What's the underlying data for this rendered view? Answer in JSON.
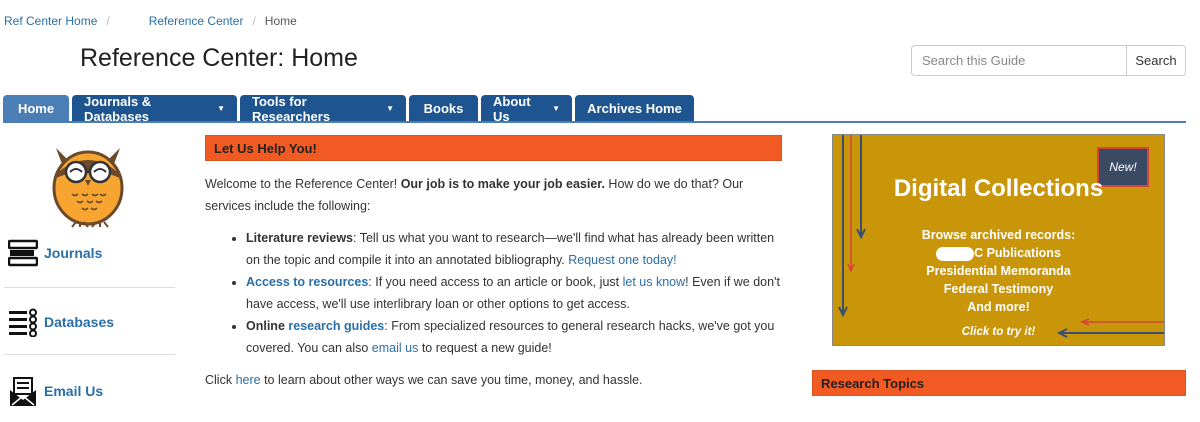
{
  "breadcrumb": {
    "home": "Ref Center Home",
    "parent": "Reference Center",
    "current": "Home",
    "separator": "/"
  },
  "page_title": "Reference Center: Home",
  "search": {
    "placeholder": "Search this Guide",
    "button": "Search"
  },
  "nav_tabs": [
    {
      "label": "Home",
      "dropdown": false,
      "active": true
    },
    {
      "label": "Journals & Databases",
      "dropdown": true
    },
    {
      "label": "Tools for Researchers",
      "dropdown": true
    },
    {
      "label": "Books",
      "dropdown": false
    },
    {
      "label": "About Us",
      "dropdown": true
    },
    {
      "label": "Archives Home",
      "dropdown": false
    }
  ],
  "sidebar": {
    "links": [
      "Journals",
      "Databases",
      "Email Us"
    ]
  },
  "help_box": {
    "heading": "Let Us Help You!",
    "intro_before": "Welcome to the Reference Center! ",
    "intro_bold": "Our job is to make your job easier.",
    "intro_after": " How do we do that? Our services include the following:",
    "items": [
      {
        "title": "Literature reviews",
        "text": ": Tell us what you want to research—we'll find what has already been written on the topic and compile it into an annotated bibliography. ",
        "link": "Request one today!"
      },
      {
        "title": "Access to resources",
        "text_1": ": If you need access to an article or book, just ",
        "link": "let us know",
        "text_2": "! Even if we don't have access, we'll use interlibrary loan or other options to get access."
      },
      {
        "title_1": "Online ",
        "title_link": "research guides",
        "text_1": ": From specialized resources to general research hacks, we've got you covered. You can also ",
        "link": "email us",
        "text_2": " to request a new guide!"
      }
    ],
    "footer_before": "Click ",
    "footer_link": "here",
    "footer_after": " to learn about other ways we can save you time, money, and hassle."
  },
  "promo": {
    "title": "Digital Collections",
    "badge": "New!",
    "lines": [
      "Browse archived records:",
      "C Publications",
      "Presidential Memoranda",
      "Federal Testimony",
      "And more!"
    ],
    "cta": "Click to try it!"
  },
  "research_topics": {
    "heading": "Research Topics"
  },
  "colors": {
    "nav_blue": "#1e5590",
    "nav_active": "#4a7eb5",
    "accent_orange": "#f15a22",
    "promo_gold": "#c9960a",
    "link_blue": "#2a6fa8"
  }
}
